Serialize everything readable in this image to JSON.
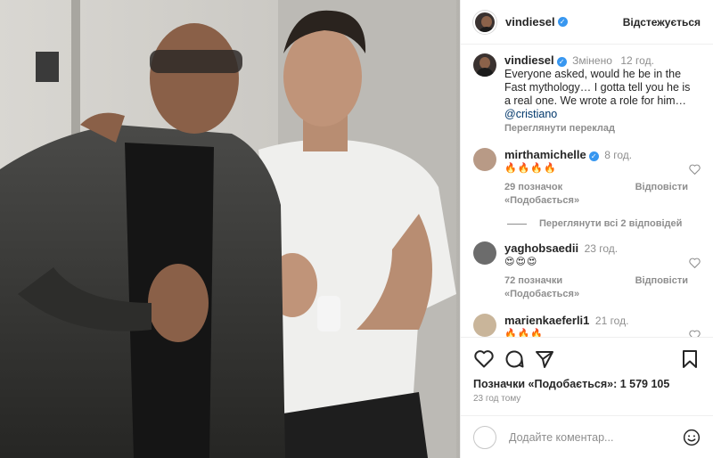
{
  "header": {
    "username": "vindiesel",
    "follow_status": "Відстежується"
  },
  "caption": {
    "username": "vindiesel",
    "edited_label": "Змінено",
    "time": "12 год.",
    "text": "Everyone asked, would he be in the Fast mythology… I gotta tell you he is a real one.  We wrote a role for him…",
    "mention": "@cristiano",
    "translate": "Переглянути переклад"
  },
  "comments": [
    {
      "username": "mirthamichelle",
      "verified": true,
      "time": "8 год.",
      "text": "🔥🔥🔥🔥",
      "likes": "29 позначок «Подобається»",
      "reply": "Відповісти",
      "avatar_color": "#b89a86",
      "replies": "Переглянути всі 2 відповідей"
    },
    {
      "username": "yaghobsaedii",
      "verified": false,
      "time": "23 год.",
      "text": "😍😍😍",
      "likes": "72 позначки «Подобається»",
      "reply": "Відповісти",
      "avatar_color": "#6c6c6c"
    },
    {
      "username": "marienkaeferli1",
      "verified": false,
      "time": "21 год.",
      "text": "🔥🔥🔥",
      "avatar_color": "#c9b59a"
    }
  ],
  "footer": {
    "likes": "Позначки «Подобається»: 1 579 105",
    "ago": "23 год тому",
    "add_comment_placeholder": "Додайте коментар..."
  },
  "colors": {
    "verified": "#3897f0",
    "muted": "#8e8e8e",
    "text": "#262626",
    "link": "#00376b"
  },
  "icons": [
    "heart-icon",
    "comment-icon",
    "share-icon",
    "bookmark-icon",
    "emoji-icon"
  ]
}
